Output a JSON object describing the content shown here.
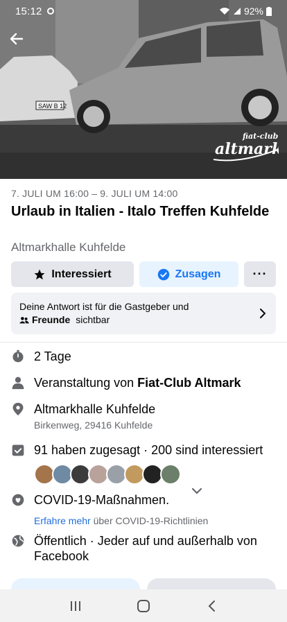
{
  "status_bar": {
    "time": "15:12",
    "battery": "92%"
  },
  "cover": {
    "brand_line1": "fiat-club",
    "brand_line2": "altmark",
    "plate": "SAW B 12"
  },
  "event": {
    "date_range": "7. JULI UM 16:00 – 9. JULI UM 14:00",
    "title": "Urlaub in Italien - Italo Treffen Kuhfelde",
    "venue": "Altmarkhalle Kuhfelde"
  },
  "actions": {
    "interested_label": "Interessiert",
    "going_label": "Zusagen",
    "more_label": "···"
  },
  "visibility_notice": {
    "line1": "Deine Antwort ist für die Gastgeber und",
    "friends_label": "Freunde",
    "line2_suffix": "sichtbar"
  },
  "details": {
    "duration": "2 Tage",
    "host_prefix": "Veranstaltung von",
    "host_name": "Fiat-Club Altmark",
    "location_name": "Altmarkhalle Kuhfelde",
    "location_address": "Birkenweg, 29416 Kuhfelde",
    "attendance": "91 haben zugesagt · 200 sind interessiert",
    "covid_label": "COVID-19-Maßnahmen.",
    "covid_link": "Erfahre mehr",
    "covid_link_suffix": "über COVID-19-Richtlinien",
    "privacy": "Öffentlich · Jeder auf und außerhalb von Facebook"
  },
  "colors": {
    "accent": "#1877f2",
    "secondary_text": "#65676b",
    "button_bg": "#e4e6eb"
  }
}
